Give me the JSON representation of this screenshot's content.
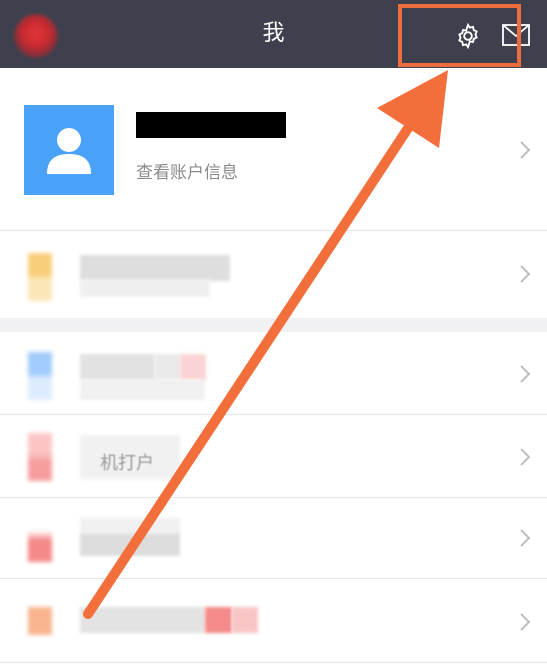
{
  "header": {
    "title": "我"
  },
  "profile": {
    "subtitle": "查看账户信息"
  },
  "menu_rows": [
    {
      "label": ""
    },
    {
      "label": ""
    },
    {
      "label": "机打户"
    },
    {
      "label": ""
    },
    {
      "label": ""
    }
  ],
  "colors": {
    "header_bg": "#3e404e",
    "avatar_blue": "#4aa2f8",
    "highlight_orange": "#ee6d3f"
  }
}
